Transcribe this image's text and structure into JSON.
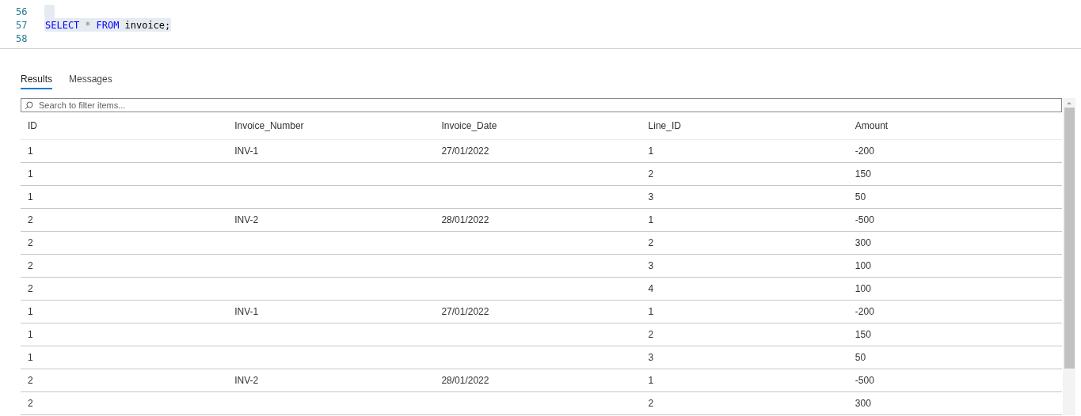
{
  "editor": {
    "lines": [
      {
        "number": "56",
        "selected": true
      },
      {
        "number": "57",
        "tokens": [
          {
            "kind": "keyword",
            "text": "SELECT"
          },
          {
            "kind": "operator",
            "text": "*"
          },
          {
            "kind": "keyword",
            "text": "FROM"
          },
          {
            "kind": "identifier",
            "text": "invoice;"
          }
        ],
        "selected": true
      },
      {
        "number": "58",
        "selected": false
      }
    ]
  },
  "tabs": [
    {
      "label": "Results",
      "selected": true
    },
    {
      "label": "Messages",
      "selected": false
    }
  ],
  "search": {
    "placeholder": "Search to filter items..."
  },
  "table": {
    "columns": [
      "ID",
      "Invoice_Number",
      "Invoice_Date",
      "Line_ID",
      "Amount"
    ],
    "rows": [
      [
        "1",
        "INV-1",
        "27/01/2022",
        "1",
        "-200"
      ],
      [
        "1",
        "",
        "",
        "2",
        "150"
      ],
      [
        "1",
        "",
        "",
        "3",
        "50"
      ],
      [
        "2",
        "INV-2",
        "28/01/2022",
        "1",
        "-500"
      ],
      [
        "2",
        "",
        "",
        "2",
        "300"
      ],
      [
        "2",
        "",
        "",
        "3",
        "100"
      ],
      [
        "2",
        "",
        "",
        "4",
        "100"
      ],
      [
        "1",
        "INV-1",
        "27/01/2022",
        "1",
        "-200"
      ],
      [
        "1",
        "",
        "",
        "2",
        "150"
      ],
      [
        "1",
        "",
        "",
        "3",
        "50"
      ],
      [
        "2",
        "INV-2",
        "28/01/2022",
        "1",
        "-500"
      ],
      [
        "2",
        "",
        "",
        "2",
        "300"
      ]
    ]
  }
}
